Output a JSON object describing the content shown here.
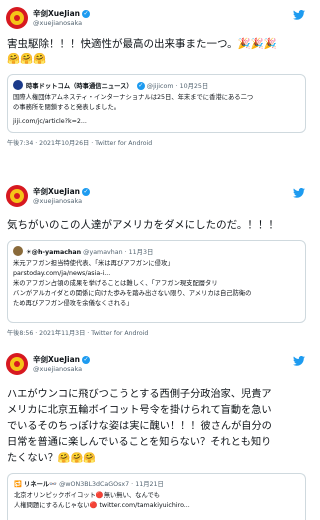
{
  "tweets": [
    {
      "author": "辛剑XueJian",
      "handle": "@xuejianosaka",
      "text_line1": "害虫駆除！！！快適性が最高の出来事また一つ。🎉🎉🎉",
      "text_line2": "🤗🤗🤗",
      "quote": {
        "name": "時事ドットコム（時事通信ニュース）",
        "handle": "@jijicom",
        "date": "10月25日",
        "body1": "国際人権団体アムネスティ・インターナショナルは25日、年末までに香港にある二つ",
        "body2": "の事務所を閉鎖すると発表しました。",
        "link": "jiji.com/jc/article?k=2..."
      },
      "meta": "午後7:34 · 2021年10月26日 · Twitter for Android"
    },
    {
      "author": "辛剑XueJian",
      "handle": "@xuejianosaka",
      "text_line1": "気ちがいのこの人達がアメリカをダメにしたのだ。！！！",
      "quote": {
        "name": "☀@h-yamachan",
        "handle": "@yamavhan",
        "date": "11月3日",
        "body1": "米元アフガン担当特使代表、「米は再びアフガンに侵攻」",
        "body2": "parstoday.com/ja/news/asia-i...",
        "body3": "米のアフガン占領の成果を挙げることは難しく、「アフガン現支配層タリ",
        "body4": "バンがアルカイダとの関係に向けた歩みを踏み出さない限り、アメリカは自己防衛の",
        "body5": "ため再びアフガン侵攻を余儀なくされる」"
      },
      "meta": "午後8:56 · 2021年11月3日 · Twitter for Android"
    },
    {
      "author": "辛剑XueJian",
      "handle": "@xuejianosaka",
      "text_line1": "ハエがウンコに飛びつこうとする西側子分政治家、児貴ア",
      "text_line2": "メリカに北京五輪ボイコット号令を掛けられて盲動を急い",
      "text_line3": "でいるそのちっぽけな姿は実に醜い！！！彼さんが自分の",
      "text_line4": "日常を普通に楽しんでいることを知らない？それとも知り",
      "text_line5": "たくない？🤗🤗🤗",
      "quote": {
        "retweet": "🔁 リネール👓",
        "handle": "@wON3BL3dCaGOsx7",
        "date": "11月21日",
        "body1": "北京オリンピックボイコット🔴無い無い、なんでも",
        "body2": "人権問題にするんじゃない🔴 twitter.com/tamakiyuichiro..."
      }
    }
  ]
}
